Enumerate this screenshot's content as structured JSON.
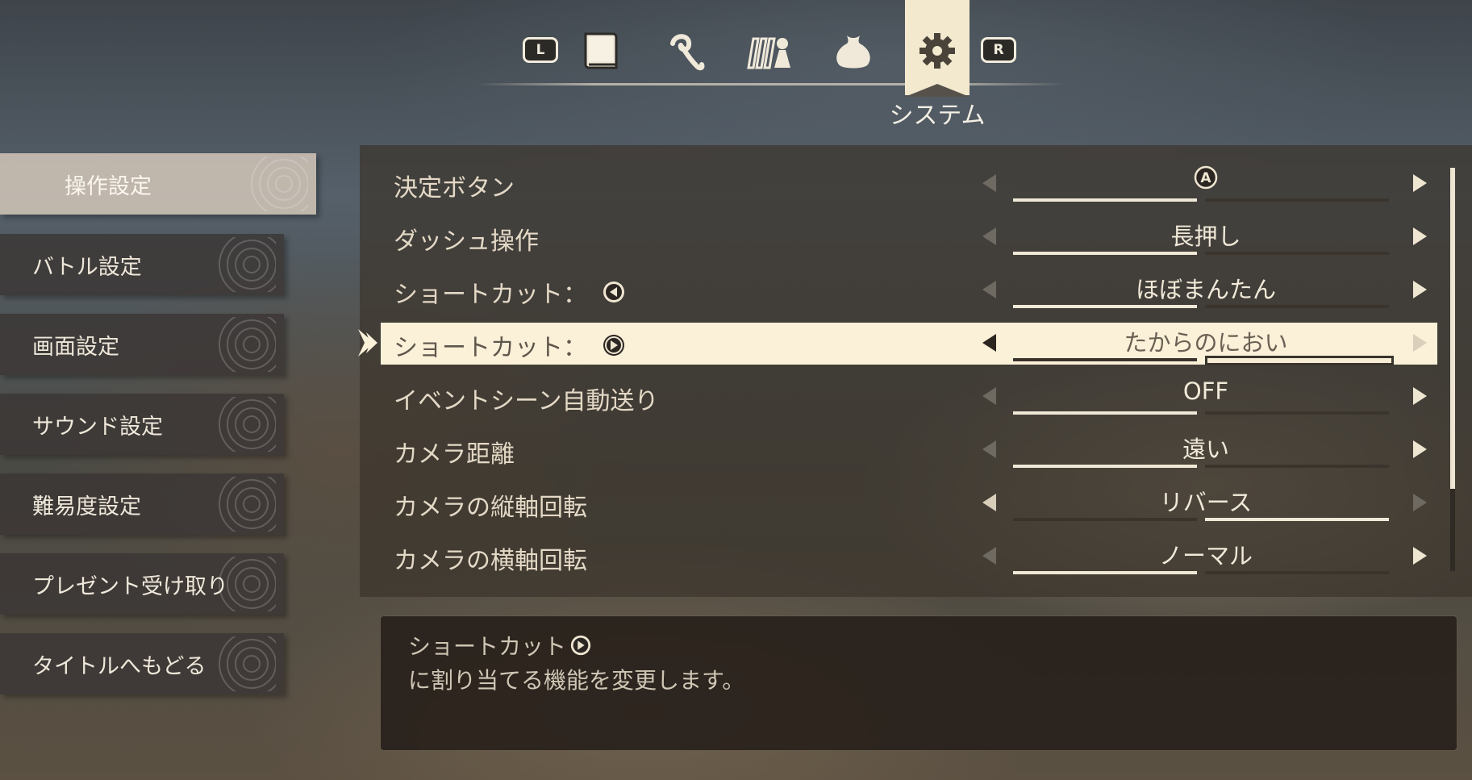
{
  "topnav": {
    "l_button": "L",
    "r_button": "R",
    "icons": [
      "book-icon",
      "skill-icon",
      "party-icon",
      "bag-icon",
      "gear-icon"
    ],
    "active_tab_label": "システム"
  },
  "sidebar": {
    "items": [
      {
        "label": "操作設定",
        "active": true
      },
      {
        "label": "バトル設定",
        "active": false
      },
      {
        "label": "画面設定",
        "active": false
      },
      {
        "label": "サウンド設定",
        "active": false
      },
      {
        "label": "難易度設定",
        "active": false
      },
      {
        "label": "プレゼント受け取り",
        "active": false
      },
      {
        "label": "タイトルへもどる",
        "active": false
      }
    ]
  },
  "settings": {
    "rows": [
      {
        "label": "決定ボタン",
        "value": "",
        "value_glyph": "A",
        "position": 1
      },
      {
        "label": "ダッシュ操作",
        "value": "長押し",
        "position": 1
      },
      {
        "label": "ショートカット：",
        "label_glyph": "left",
        "value": "ほぼまんたん",
        "position": 1
      },
      {
        "label": "ショートカット：",
        "label_glyph": "right",
        "value": "たからのにおい",
        "position": 2,
        "selected": true
      },
      {
        "label": "イベントシーン自動送り",
        "value": "OFF",
        "position": 1
      },
      {
        "label": "カメラ距離",
        "value": "遠い",
        "position": 1
      },
      {
        "label": "カメラの縦軸回転",
        "value": "リバース",
        "position": 2
      },
      {
        "label": "カメラの横軸回転",
        "value": "ノーマル",
        "position": 1
      }
    ]
  },
  "description": {
    "line1": "ショートカット",
    "line2": "に割り当てる機能を変更します。"
  },
  "colors": {
    "highlight": "#fbf0d8",
    "text_light": "#f1e9d8",
    "panel": "#3c342c"
  }
}
